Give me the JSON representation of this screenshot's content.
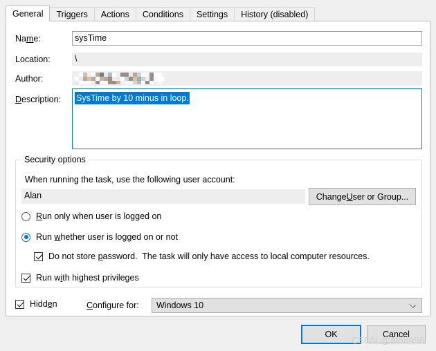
{
  "tabs": [
    {
      "label": "General",
      "active": true
    },
    {
      "label": "Triggers",
      "active": false
    },
    {
      "label": "Actions",
      "active": false
    },
    {
      "label": "Conditions",
      "active": false
    },
    {
      "label": "Settings",
      "active": false
    },
    {
      "label": "History (disabled)",
      "active": false
    }
  ],
  "fields": {
    "name_label": "Name:",
    "name_value": "sysTime",
    "location_label": "Location:",
    "location_value": "\\",
    "author_label": "Author:",
    "author_value": "",
    "description_label": "Description:",
    "description_value": "SysTime by 10 minus in loop."
  },
  "security": {
    "group_title": "Security options",
    "account_prompt": "When running the task, use the following user account:",
    "account_value": "Alan",
    "change_user_button": "Change User or Group...",
    "radio_logged_on": "Run only when user is logged on",
    "radio_whether_logged_on": "Run whether user is logged on or not",
    "radio_selected": "whether",
    "checkbox_no_password": "Do not store password.  The task will only have access to local computer resources.",
    "checkbox_no_password_checked": true,
    "checkbox_highest_privileges": "Run with highest privileges",
    "checkbox_highest_privileges_checked": true
  },
  "bottom": {
    "hidden_label": "Hidden",
    "hidden_checked": true,
    "configure_for_label": "Configure for:",
    "configure_for_value": "Windows 10"
  },
  "buttons": {
    "ok": "OK",
    "cancel": "Cancel"
  },
  "watermark": "CSDN @Alan996",
  "colors": {
    "accent": "#0078d7",
    "window_bg": "#f0f0f0",
    "panel_bg": "#ffffff",
    "readonly_bg": "#eeeeee",
    "button_bg": "#e1e1e1"
  }
}
